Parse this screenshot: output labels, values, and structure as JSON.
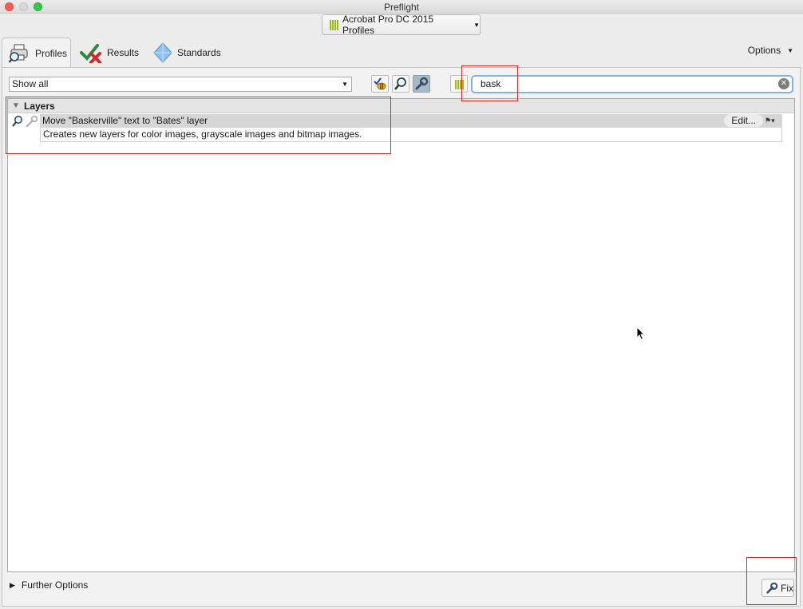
{
  "window": {
    "title": "Preflight"
  },
  "profile_selector": {
    "label": "Acrobat Pro DC 2015 Profiles"
  },
  "tabs": [
    {
      "label": "Profiles",
      "icon": "printer-magnifier-icon",
      "selected": true
    },
    {
      "label": "Results",
      "icon": "check-x-icon",
      "selected": false
    },
    {
      "label": "Standards",
      "icon": "diamond-icon",
      "selected": false
    }
  ],
  "options": {
    "label": "Options"
  },
  "filter": {
    "selected": "Show all"
  },
  "search": {
    "value": "bask"
  },
  "list": {
    "group_label": "Layers",
    "items": [
      {
        "title": "Move \"Baskerville\" text to \"Bates\" layer",
        "description": "Creates new layers for color images, grayscale images and bitmap images.",
        "edit_label": "Edit..."
      }
    ]
  },
  "further_options": {
    "label": "Further Options"
  },
  "fix_button": {
    "label": "Fix"
  },
  "colors": {
    "annotation": "#e0291c",
    "search_focus": "#7fb2ec",
    "profile_bars": "#9cbc1a"
  }
}
